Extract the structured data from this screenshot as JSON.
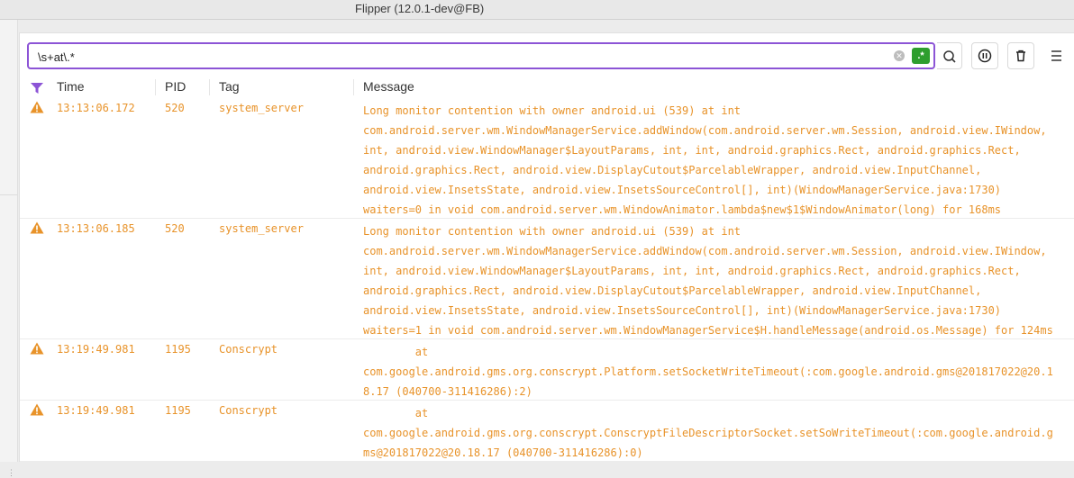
{
  "window": {
    "title": "Flipper (12.0.1-dev@FB)"
  },
  "search": {
    "value": "\\s+at\\.*",
    "regex_label": ".*"
  },
  "columns": {
    "time": "Time",
    "pid": "PID",
    "tag": "Tag",
    "message": "Message"
  },
  "colors": {
    "warning": "#e8932a",
    "accent": "#8c54d6",
    "regex": "#2e9e2e"
  },
  "rows": [
    {
      "level_icon": "warning-icon",
      "time": "13:13:06.172",
      "pid": "520",
      "tag": "system_server",
      "message": "Long monitor contention with owner android.ui (539) at int\ncom.android.server.wm.WindowManagerService.addWindow(com.android.server.wm.Session, android.view.IWindow,\nint, android.view.WindowManager$LayoutParams, int, int, android.graphics.Rect, android.graphics.Rect,\nandroid.graphics.Rect, android.view.DisplayCutout$ParcelableWrapper, android.view.InputChannel,\nandroid.view.InsetsState, android.view.InsetsSourceControl[], int)(WindowManagerService.java:1730)\nwaiters=0 in void com.android.server.wm.WindowAnimator.lambda$new$1$WindowAnimator(long) for 168ms"
    },
    {
      "level_icon": "warning-icon",
      "time": "13:13:06.185",
      "pid": "520",
      "tag": "system_server",
      "message": "Long monitor contention with owner android.ui (539) at int\ncom.android.server.wm.WindowManagerService.addWindow(com.android.server.wm.Session, android.view.IWindow,\nint, android.view.WindowManager$LayoutParams, int, int, android.graphics.Rect, android.graphics.Rect,\nandroid.graphics.Rect, android.view.DisplayCutout$ParcelableWrapper, android.view.InputChannel,\nandroid.view.InsetsState, android.view.InsetsSourceControl[], int)(WindowManagerService.java:1730)\nwaiters=1 in void com.android.server.wm.WindowManagerService$H.handleMessage(android.os.Message) for 124ms"
    },
    {
      "level_icon": "warning-icon",
      "time": "13:19:49.981",
      "pid": "1195",
      "tag": "Conscrypt",
      "message": "        at\ncom.google.android.gms.org.conscrypt.Platform.setSocketWriteTimeout(:com.google.android.gms@201817022@20.1\n8.17 (040700-311416286):2)"
    },
    {
      "level_icon": "warning-icon",
      "time": "13:19:49.981",
      "pid": "1195",
      "tag": "Conscrypt",
      "message": "        at\ncom.google.android.gms.org.conscrypt.ConscryptFileDescriptorSocket.setSoWriteTimeout(:com.google.android.g\nms@201817022@20.18.17 (040700-311416286):0)"
    }
  ]
}
